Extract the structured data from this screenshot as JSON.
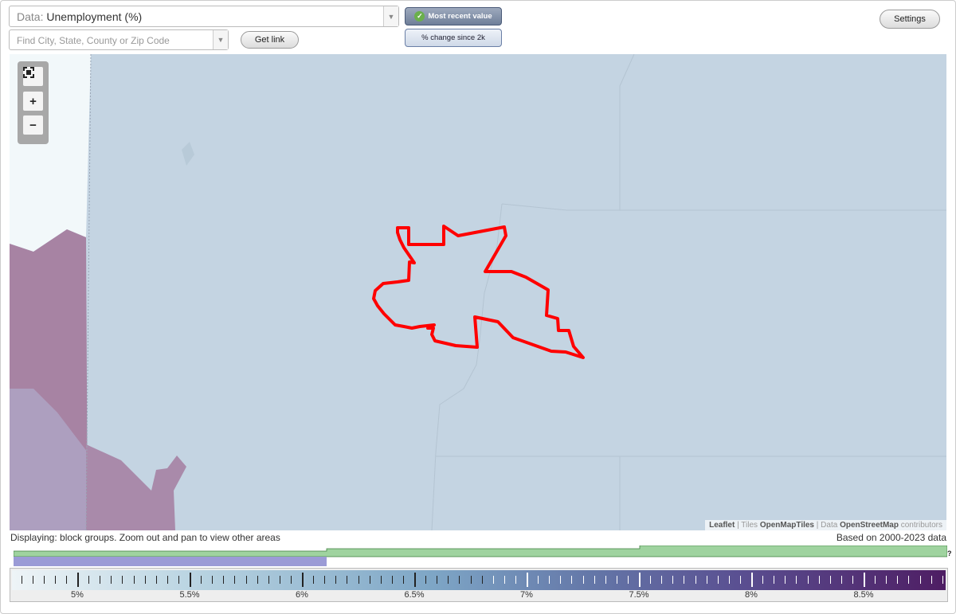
{
  "data_select": {
    "prefix": "Data:",
    "value": "Unemployment (%)"
  },
  "search": {
    "placeholder": "Find City, State, County or Zip Code"
  },
  "buttons": {
    "get_link": "Get link",
    "settings": "Settings"
  },
  "toggles": {
    "most_recent": "Most recent value",
    "pct_change": "% change since 2k"
  },
  "map": {
    "attribution": {
      "leaflet": "Leaflet",
      "sep1": " | Tiles ",
      "tiles": "OpenMapTiles",
      "sep2": " | Data ",
      "osm": "OpenStreetMap",
      "suffix": " contributors"
    },
    "colors": {
      "water": "#c4d4e2",
      "outline": "#ff0000",
      "light_region": "#f4f9fb",
      "dark_region": "#a783a3"
    }
  },
  "status": {
    "displaying": "Displaying: block groups. Zoom out and pan to view other areas",
    "based_on": "Based on 2000-2023 data",
    "help": "?"
  },
  "legend": {
    "labels": [
      "5%",
      "5.5%",
      "6%",
      "6.5%",
      "7%",
      "7.5%",
      "8%",
      "8.5%"
    ]
  }
}
